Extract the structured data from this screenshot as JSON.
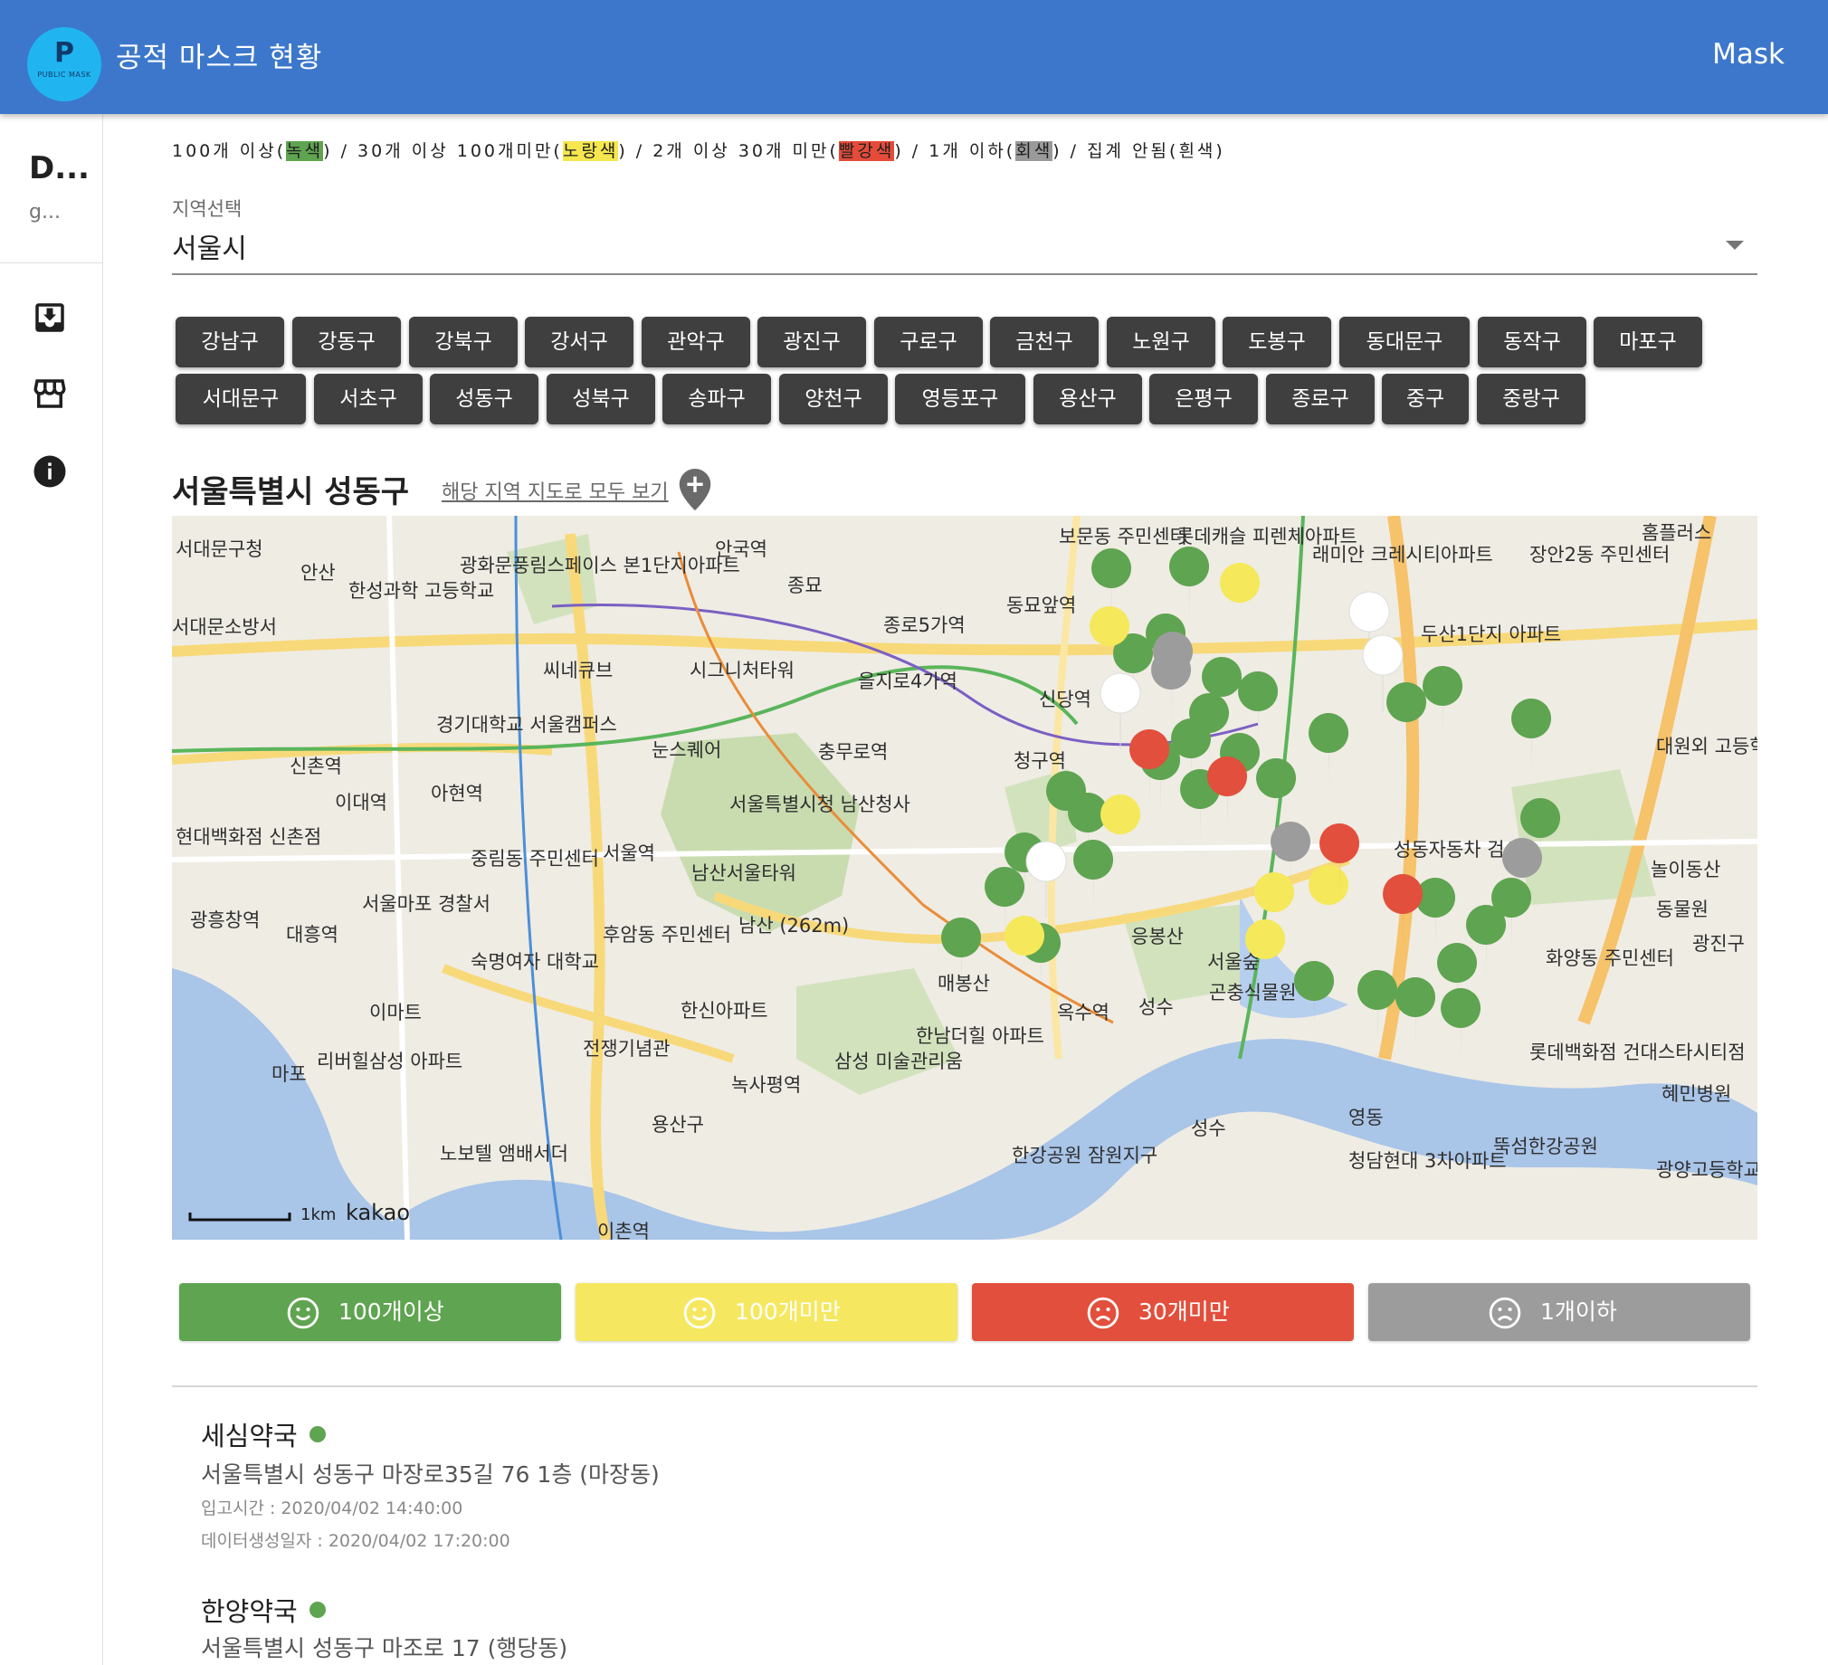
{
  "appbar": {
    "logo_letter": "P",
    "logo_sub": "PUBLIC MASK",
    "title": "공적 마스크 현황",
    "right_label": "Mask"
  },
  "sidenav": {
    "title": "D...",
    "subtitle": "g...",
    "icons": [
      "inbox-download-icon",
      "store-icon",
      "info-icon"
    ]
  },
  "legend": {
    "p1": "100개 이상(",
    "green": "녹색",
    "p2": ") / 30개 이상 100개미만(",
    "yellow": "노랑색",
    "p3": ") / 2개 이상 30개 미만(",
    "red": "빨강색",
    "p4": ") / 1개 이하(",
    "gray": "회색",
    "p5": ") / 집계 안됨(흰색)"
  },
  "region_select": {
    "label": "지역선택",
    "value": "서울시"
  },
  "districts": [
    "강남구",
    "강동구",
    "강북구",
    "강서구",
    "관악구",
    "광진구",
    "구로구",
    "금천구",
    "노원구",
    "도봉구",
    "동대문구",
    "동작구",
    "마포구",
    "서대문구",
    "서초구",
    "성동구",
    "성북구",
    "송파구",
    "양천구",
    "영등포구",
    "용산구",
    "은평구",
    "종로구",
    "중구",
    "중랑구"
  ],
  "region": {
    "title": "서울특별시 성동구",
    "view_all_link": "해당 지역 지도로 모두 보기"
  },
  "map": {
    "labels": [
      "서대문구청",
      "안산",
      "한성과학 고등학교",
      "광화문풍림스페이스 본1단지아파트",
      "안국역",
      "종묘",
      "보문동 주민센터",
      "롯데캐슬 피렌체아파트",
      "래미안 크레시티아파트",
      "장안2동 주민센터",
      "홈플러스",
      "서대문소방서",
      "종로5가역",
      "동묘앞역",
      "두산1단지 아파트",
      "씨네큐브",
      "시그니처타워",
      "을지로4가역",
      "신당역",
      "경기대학교 서울캠퍼스",
      "눈스퀘어",
      "충무로역",
      "청구역",
      "신촌역",
      "이대역",
      "아현역",
      "서울특별시청 남산청사",
      "현대백화점 신촌점",
      "중림동 주민센터",
      "서울역",
      "서울마포 경찰서",
      "남산서울타워",
      "남산 (262m)",
      "후암동 주민센터",
      "성동자동차 검사소",
      "광흥창역",
      "대흥역",
      "숙명여자 대학교",
      "응봉산",
      "서울숲",
      "곤충식물원",
      "화양동 주민센터",
      "놀이동산",
      "동물원",
      "광진구",
      "이마트",
      "매봉산",
      "한신아파트",
      "옥수역",
      "성수",
      "전쟁기념관",
      "리버힐삼성 아파트",
      "마포",
      "한남더힐 아파트",
      "삼성 미술관리움",
      "녹사평역",
      "롯데백화점 건대스타시티점",
      "혜민병원",
      "용산구",
      "성수",
      "영동",
      "뚝섬한강공원",
      "노보텔 앰배서더",
      "한강공원 잠원지구",
      "청담현대 3차아파트",
      "광양고등학교",
      "이촌역",
      "대원외 고등학교",
      "1km",
      "kakao"
    ]
  },
  "status_buttons": [
    {
      "label": "100개이상",
      "color": "#5fa450",
      "icon": "smile-icon"
    },
    {
      "label": "100개미만",
      "color": "#f5e860",
      "icon": "smile-icon"
    },
    {
      "label": "30개미만",
      "color": "#e24f3c",
      "icon": "frown-icon"
    },
    {
      "label": "1개이하",
      "color": "#9c9c9c",
      "icon": "frown-icon"
    }
  ],
  "pharmacies": [
    {
      "name": "세심약국",
      "address": "서울특별시 성동구 마장로35길 76 1층 (마장동)",
      "stock_time": "입고시간 : 2020/04/02 14:40:00",
      "created_at": "데이터생성일자 : 2020/04/02 17:20:00",
      "status_color": "#5fa450"
    },
    {
      "name": "한양약국",
      "address": "서울특별시 성동구 마조로 17 (행당동)",
      "status_color": "#5fa450"
    }
  ]
}
